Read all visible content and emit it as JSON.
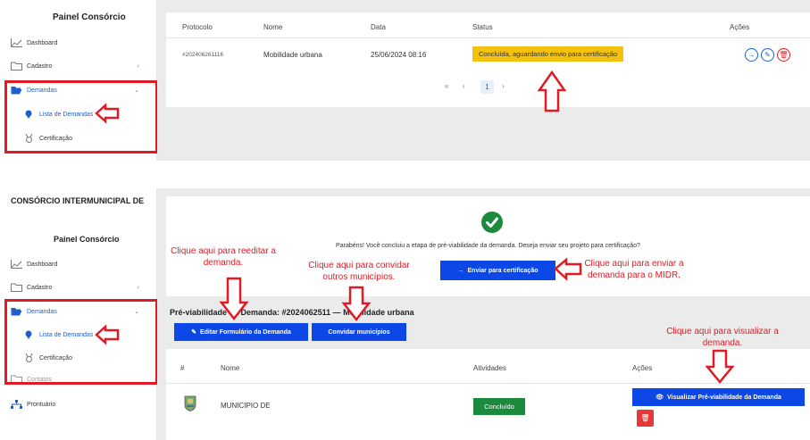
{
  "top": {
    "sidebar": {
      "title": "Painel Consórcio",
      "items": [
        {
          "label": "Dashboard"
        },
        {
          "label": "Cadastro"
        },
        {
          "label": "Demandas"
        },
        {
          "label": "Lista de Demandas"
        },
        {
          "label": "Certificação"
        }
      ]
    },
    "table": {
      "headers": [
        "Protocolo",
        "Nome",
        "Data",
        "Status",
        "Ações"
      ],
      "row": {
        "protocolo": "#202406261116",
        "nome": "Mobilidade urbana",
        "data": "25/06/2024 08:16",
        "status": "Concluída, aguardando envio para certificação"
      }
    },
    "pagination": {
      "first": "«",
      "prev": "‹",
      "current": "1",
      "next": "›"
    }
  },
  "bottom": {
    "sidebar": {
      "org": "CONSÓRCIO INTERMUNICIPAL DE",
      "title": "Painel Consórcio",
      "items": [
        {
          "label": "Dashboard"
        },
        {
          "label": "Cadastro"
        },
        {
          "label": "Demandas"
        },
        {
          "label": "Lista de Demandas"
        },
        {
          "label": "Certificação"
        },
        {
          "label": "Contatos"
        },
        {
          "label": "Prontuário"
        }
      ]
    },
    "message": "Parabéns! Você concluiu a etapa de pré-viabilidade da demanda. Deseja enviar seu projeto para certificação?",
    "send_button": "Enviar para certificação",
    "section_title": "Pré-viabilidade da Demanda: #2024062511 — Mobilidade urbana",
    "edit_button": "Editar Formulário da Demanda",
    "invite_button": "Convidar municípios",
    "table": {
      "headers": [
        "#",
        "Nome",
        "Atividades",
        "Ações"
      ],
      "row": {
        "nome": "MUNICIPIO DE",
        "atividades": "Concluído"
      }
    },
    "view_button": "Visualizar Pré-viabilidade da Demanda"
  },
  "annotations": {
    "reedit": "Clique aqui para reeditar a demanda.",
    "invite": "Clique aqui para convidar outros municípios.",
    "send": "Clique aqui para enviar a demanda para o MIDR.",
    "view": "Clique aqui para visualizar a demanda."
  },
  "colors": {
    "accent": "#0d47e6",
    "warning": "#f4c20d",
    "success": "#1c8a3c",
    "danger": "#e01b24"
  }
}
